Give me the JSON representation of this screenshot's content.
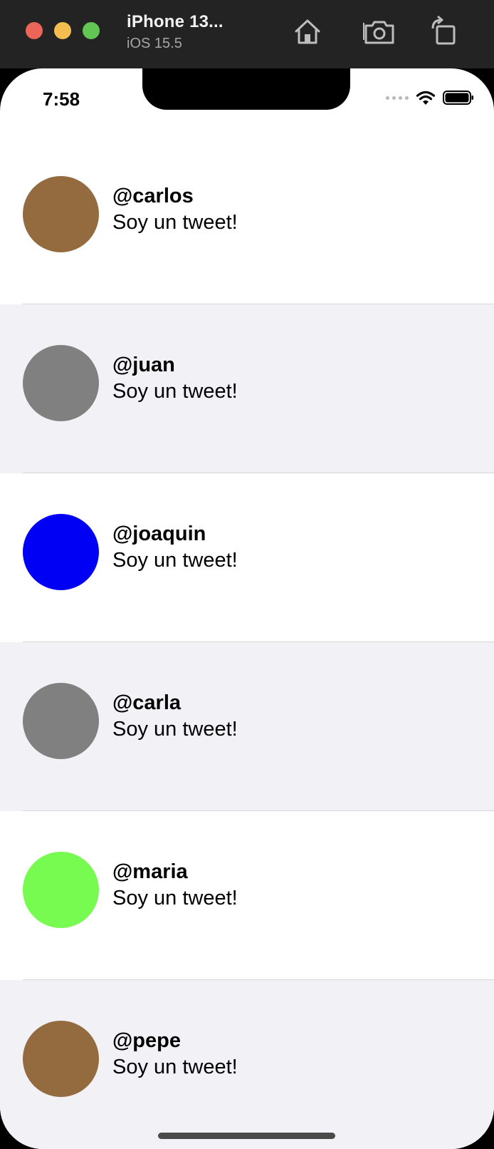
{
  "simulator": {
    "device_name": "iPhone 13...",
    "os_version": "iOS 15.5"
  },
  "status_bar": {
    "time": "7:58"
  },
  "tweets": [
    {
      "username": "@carlos",
      "text": "Soy un tweet!",
      "avatar_color": "#936b3e"
    },
    {
      "username": "@juan",
      "text": "Soy un tweet!",
      "avatar_color": "#808080"
    },
    {
      "username": "@joaquin",
      "text": "Soy un tweet!",
      "avatar_color": "#0000f5"
    },
    {
      "username": "@carla",
      "text": "Soy un tweet!",
      "avatar_color": "#808080"
    },
    {
      "username": "@maria",
      "text": "Soy un tweet!",
      "avatar_color": "#78fb50"
    },
    {
      "username": "@pepe",
      "text": "Soy un tweet!",
      "avatar_color": "#936b3e"
    }
  ]
}
